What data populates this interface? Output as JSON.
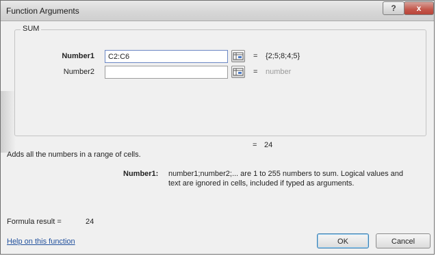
{
  "window": {
    "title": "Function Arguments",
    "help_glyph": "?",
    "close_glyph": "x"
  },
  "function": {
    "name": "SUM",
    "args": [
      {
        "label": "Number1",
        "value": "C2:C6",
        "equals": "=",
        "result": "{2;5;8;4;5}",
        "bold": true
      },
      {
        "label": "Number2",
        "value": "",
        "equals": "=",
        "result": "number",
        "bold": false
      }
    ],
    "total_equals": "=",
    "total": "24"
  },
  "description": "Adds all the numbers in a range of cells.",
  "arg_help": {
    "label": "Number1:",
    "line1": "number1;number2;... are 1 to 255 numbers to sum. Logical values and",
    "line2": "text are ignored in cells, included if typed as arguments."
  },
  "formula_result": {
    "label": "Formula result =",
    "value": "24"
  },
  "footer": {
    "help_link": "Help on this function",
    "ok": "OK",
    "cancel": "Cancel"
  },
  "icons": {
    "help": "help-icon",
    "close": "close-icon",
    "ref": "collapse-dialog-icon"
  }
}
